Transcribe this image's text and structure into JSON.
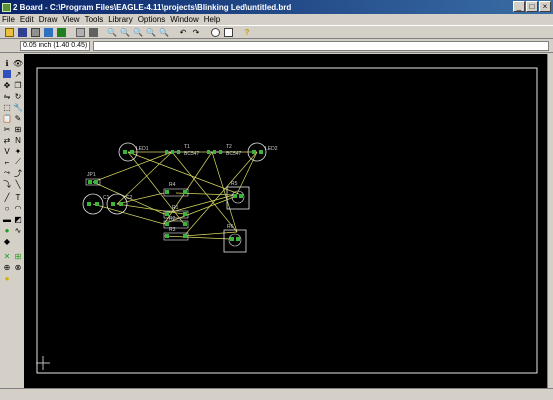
{
  "window": {
    "title": "2 Board - C:\\Program Files\\EAGLE-4.11\\projects\\Blinking Led\\untitled.brd"
  },
  "menu": [
    "File",
    "Edit",
    "Draw",
    "View",
    "Tools",
    "Library",
    "Options",
    "Window",
    "Help"
  ],
  "coord_display": "0.05 inch (1.40 0.45)",
  "command_input": "",
  "colors": {
    "canvas": "#000000",
    "outline": "#e6e6e6",
    "airwire": "#d8d860",
    "pad": "#3cb43c",
    "label": "#d0d0d0"
  },
  "components": [
    {
      "name": "LED1"
    },
    {
      "name": "T1",
      "value": "BC547"
    },
    {
      "name": "T2",
      "value": "BC547"
    },
    {
      "name": "LED2"
    },
    {
      "name": "JP1"
    },
    {
      "name": "C1"
    },
    {
      "name": "C2"
    },
    {
      "name": "R4"
    },
    {
      "name": "R5"
    },
    {
      "name": "R1"
    },
    {
      "name": "R2"
    },
    {
      "name": "R3"
    },
    {
      "name": "R6"
    }
  ]
}
